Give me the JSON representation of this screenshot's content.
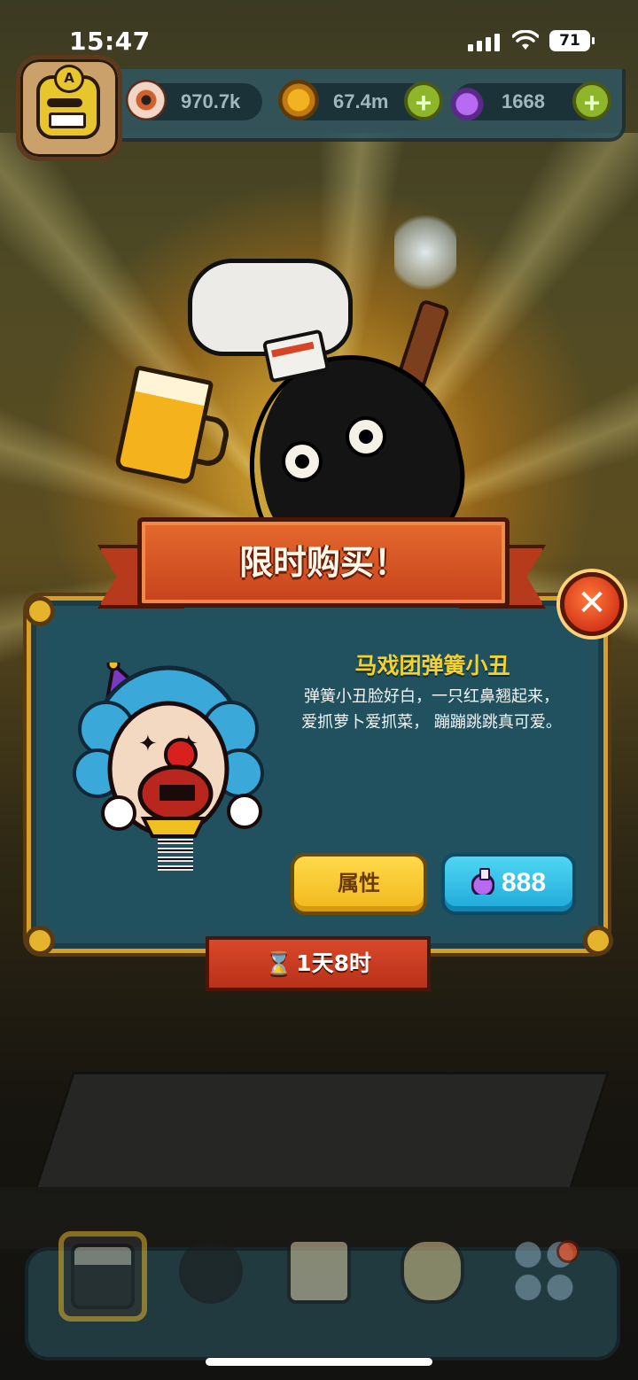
{
  "status_bar": {
    "time": "15:47",
    "battery": "71"
  },
  "resources": {
    "eyes": "970.7k",
    "coins": "67.4m",
    "potions": "1668",
    "plus_label": "+"
  },
  "avatar": {
    "badge": "A"
  },
  "offer": {
    "banner_title": "限时购买！",
    "close_label": "✕",
    "item_name": "马戏团弹簧小丑",
    "item_desc": "弹簧小丑脸好白，一只红鼻翘起来，\n爱抓萝卜爱抓菜， 蹦蹦跳跳真可爱。",
    "attr_button": "属性",
    "price": "888",
    "timer_icon": "⌛",
    "timer": "1天8时"
  },
  "bottom_nav": {
    "items": [
      "shop-icon",
      "character-icon",
      "book-icon",
      "bag-icon",
      "grid-icon"
    ]
  },
  "colors": {
    "panel": "#24505e",
    "gold_frame": "#d79f2a",
    "ribbon": "#c8421c",
    "title_yellow": "#f4d22c",
    "buy_blue": "#1fa8d8",
    "attr_yellow": "#f0b81c"
  }
}
